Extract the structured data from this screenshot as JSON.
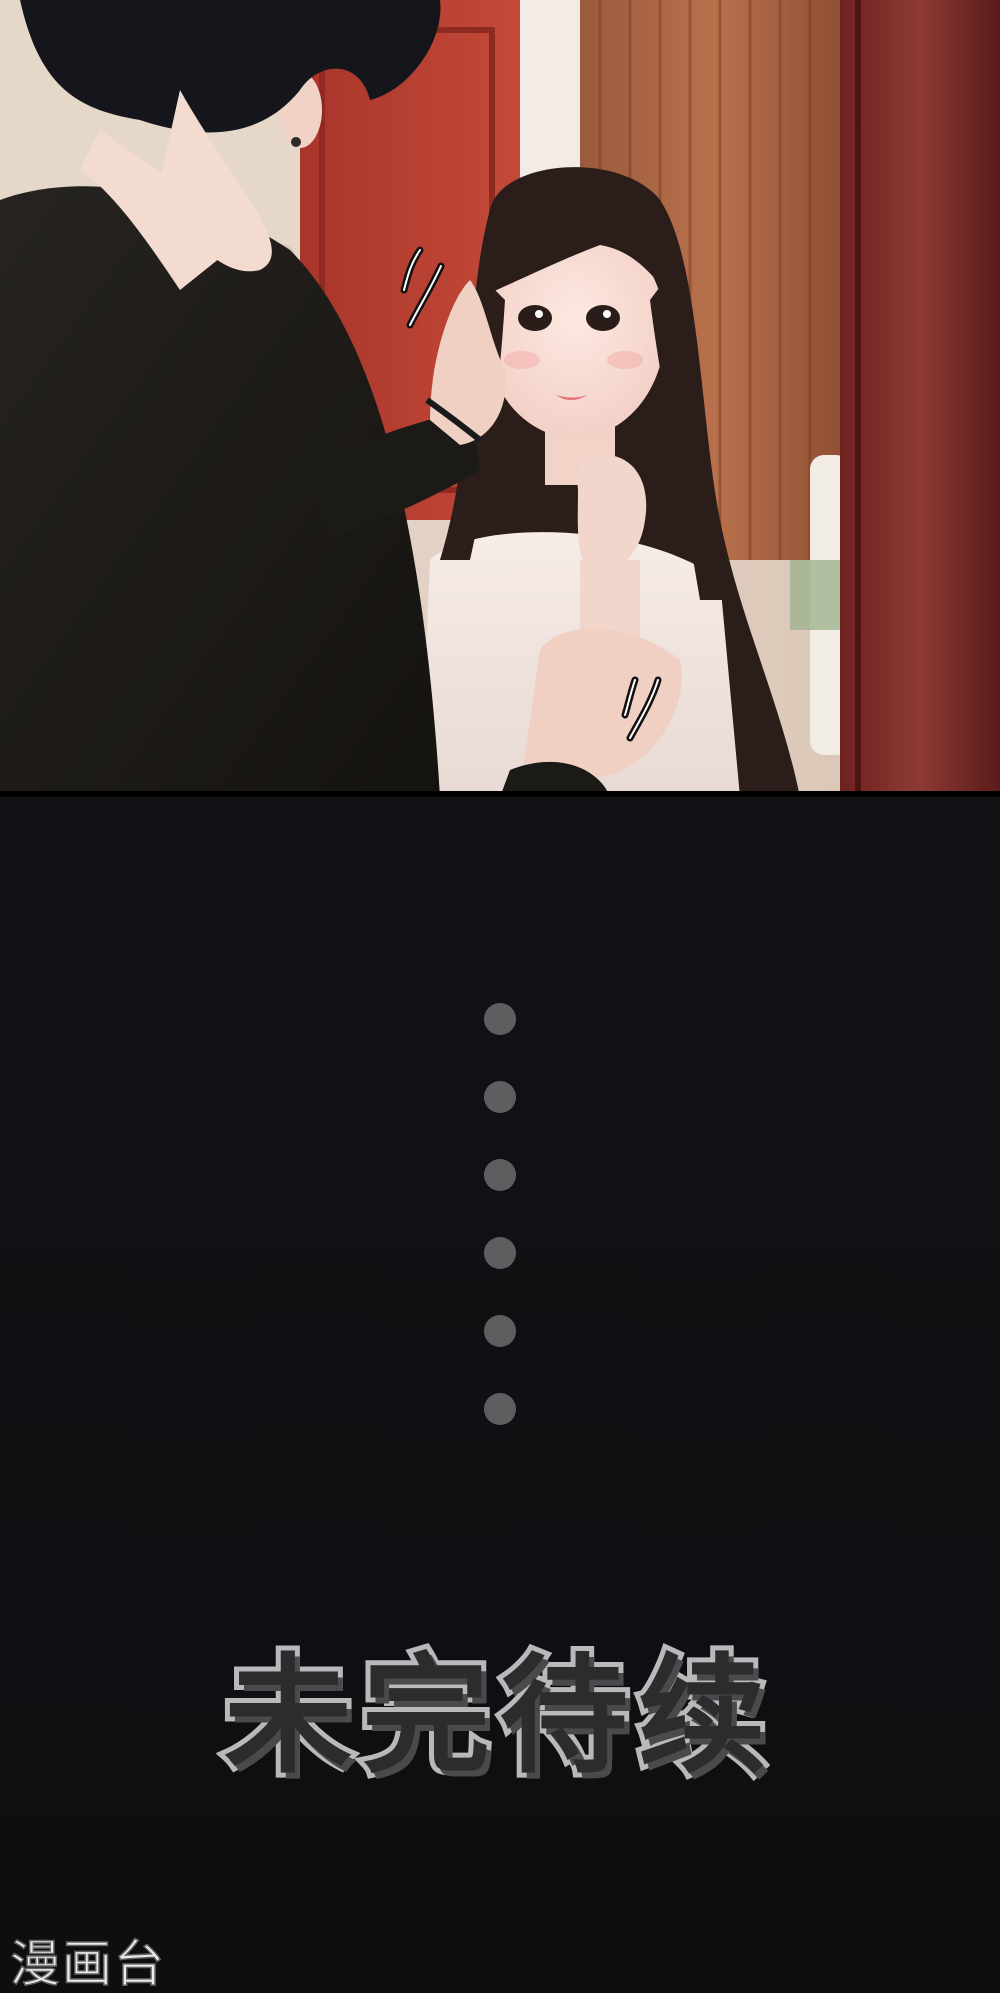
{
  "panel": {
    "to_be_continued": "未完待续",
    "dot_count": 6
  },
  "footer": {
    "watermark": "漫画台"
  },
  "colors": {
    "background": "#121115",
    "dot": "#5e5d60",
    "title_outline": "#b9b8bb",
    "title_fill": "#2c2b2e"
  }
}
